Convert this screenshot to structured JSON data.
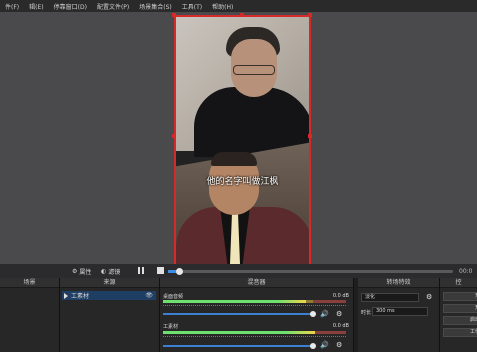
{
  "menu": [
    "件(F)",
    "辑(E)",
    "停靠窗口(D)",
    "配置文件(P)",
    "场景集合(S)",
    "工具(T)",
    "帮助(H)"
  ],
  "preview": {
    "subtitle": "他的名字叫做江枫"
  },
  "controls": {
    "properties_label": "属性",
    "filters_label": "滤镜",
    "time": "00:0"
  },
  "docks": {
    "scenes_title": "场景",
    "sources_title": "来源",
    "source_item": "工素材",
    "mixer_title": "混音器",
    "transitions_title": "转场特效",
    "controls_title": "控"
  },
  "mixer": {
    "channels": [
      {
        "name": "桌面音频",
        "db": "0.0 dB",
        "level": 0.78
      },
      {
        "name": "工素材",
        "db": "0.0 dB",
        "level": 0.83
      }
    ]
  },
  "transitions": {
    "selected": "淡化",
    "duration_label": "时长",
    "duration_value": "300 ms"
  },
  "control_buttons": [
    "开",
    "开",
    "启动",
    "工作"
  ],
  "colors": {
    "selection_border": "#d42a2a",
    "accent": "#3a8ee6",
    "source_highlight": "#1f3e63"
  }
}
